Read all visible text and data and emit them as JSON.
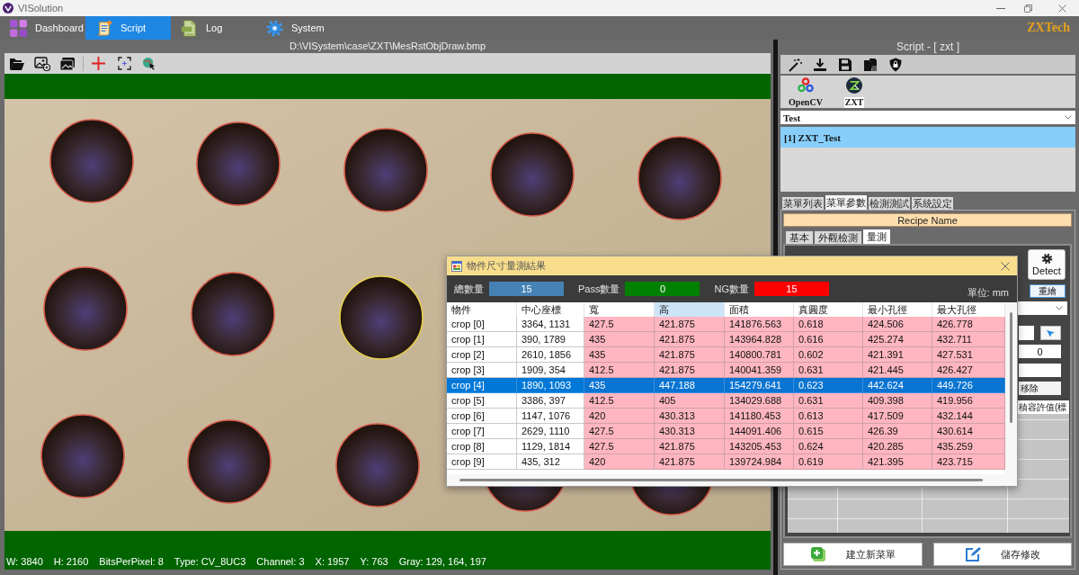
{
  "window": {
    "title": "VISolution"
  },
  "nav_bar": {
    "tabs": [
      {
        "label": "Dashboard",
        "selected": false
      },
      {
        "label": "Script",
        "selected": true
      },
      {
        "label": "Log",
        "selected": false
      },
      {
        "label": "System",
        "selected": false
      }
    ],
    "brand": "ZXTech"
  },
  "viewer": {
    "file_path": "D:\\VISystem\\case\\ZXT\\MesRstObjDraw.bmp",
    "status": [
      "W: 3840",
      "H: 2160",
      "BitsPerPixel: 8",
      "Type: CV_8UC3",
      "Channel: 3",
      "X: 1957",
      "Y: 763",
      "Gray: 129, 164, 197"
    ]
  },
  "script_panel": {
    "title": "Script - [ zxt ]",
    "plugins": [
      {
        "label": "OpenCV",
        "selected": false
      },
      {
        "label": "ZXT",
        "selected": true
      }
    ],
    "recipe_select": {
      "value": "Test"
    },
    "recipes": [
      {
        "label": "[1] ZXT_Test",
        "selected": true
      }
    ],
    "tabs": [
      {
        "label": "菜單列表",
        "selected": false
      },
      {
        "label": "菜單參數",
        "selected": true
      },
      {
        "label": "檢測測試",
        "selected": false
      },
      {
        "label": "系統設定",
        "selected": false
      }
    ],
    "recipe_name": "Recipe Name",
    "sub_tabs": [
      {
        "label": "基本",
        "selected": false
      },
      {
        "label": "外觀檢測",
        "selected": false
      },
      {
        "label": "量測",
        "selected": true
      }
    ],
    "detect_button": "Detect",
    "redraw_button": "重繪",
    "count_field": {
      "value": "0"
    },
    "remove_button": "移除",
    "grid_column": "積容許值(標",
    "buttons": [
      "建立新菜單",
      "儲存修改"
    ]
  },
  "dialog": {
    "title": "物件尺寸量測結果",
    "summary": [
      {
        "label": "總數量",
        "value": "15",
        "color": "#4682b4"
      },
      {
        "label": "Pass數量",
        "value": "0",
        "color": "#008000"
      },
      {
        "label": "NG數量",
        "value": "15",
        "color": "#ff0000"
      }
    ],
    "unit": "單位: mm",
    "columns": [
      {
        "label": "物件",
        "selected": false
      },
      {
        "label": "中心座標",
        "selected": false
      },
      {
        "label": "寬",
        "selected": false
      },
      {
        "label": "高",
        "selected": true
      },
      {
        "label": "面積",
        "selected": false
      },
      {
        "label": "真圓度",
        "selected": false
      },
      {
        "label": "最小孔徑",
        "selected": false
      },
      {
        "label": "最大孔徑",
        "selected": false
      }
    ],
    "rows": [
      {
        "cells": [
          "crop [0]",
          "3364, 1131",
          "427.5",
          "421.875",
          "141876.563",
          "0.618",
          "424.506",
          "426.778"
        ],
        "selected": false,
        "ng": true
      },
      {
        "cells": [
          "crop [1]",
          "390, 1789",
          "435",
          "421.875",
          "143964.828",
          "0.616",
          "425.274",
          "432.711"
        ],
        "selected": false,
        "ng": true
      },
      {
        "cells": [
          "crop [2]",
          "2610, 1856",
          "435",
          "421.875",
          "140800.781",
          "0.602",
          "421.391",
          "427.531"
        ],
        "selected": false,
        "ng": true
      },
      {
        "cells": [
          "crop [3]",
          "1909, 354",
          "412.5",
          "421.875",
          "140041.359",
          "0.631",
          "421.445",
          "426.427"
        ],
        "selected": false,
        "ng": true
      },
      {
        "cells": [
          "crop [4]",
          "1890, 1093",
          "435",
          "447.188",
          "154279.641",
          "0.623",
          "442.624",
          "449.726"
        ],
        "selected": true,
        "ng": true
      },
      {
        "cells": [
          "crop [5]",
          "3386, 397",
          "412.5",
          "405",
          "134029.688",
          "0.631",
          "409.398",
          "419.956"
        ],
        "selected": false,
        "ng": true
      },
      {
        "cells": [
          "crop [6]",
          "1147, 1076",
          "420",
          "430.313",
          "141180.453",
          "0.613",
          "417.509",
          "432.144"
        ],
        "selected": false,
        "ng": true
      },
      {
        "cells": [
          "crop [7]",
          "2629, 1110",
          "427.5",
          "430.313",
          "144091.406",
          "0.615",
          "426.39",
          "430.614"
        ],
        "selected": false,
        "ng": true
      },
      {
        "cells": [
          "crop [8]",
          "1129, 1814",
          "427.5",
          "421.875",
          "143205.453",
          "0.624",
          "420.285",
          "435.259"
        ],
        "selected": false,
        "ng": true
      },
      {
        "cells": [
          "crop [9]",
          "435, 312",
          "420",
          "421.875",
          "139724.984",
          "0.619",
          "421.395",
          "423.715"
        ],
        "selected": false,
        "ng": true
      }
    ]
  }
}
